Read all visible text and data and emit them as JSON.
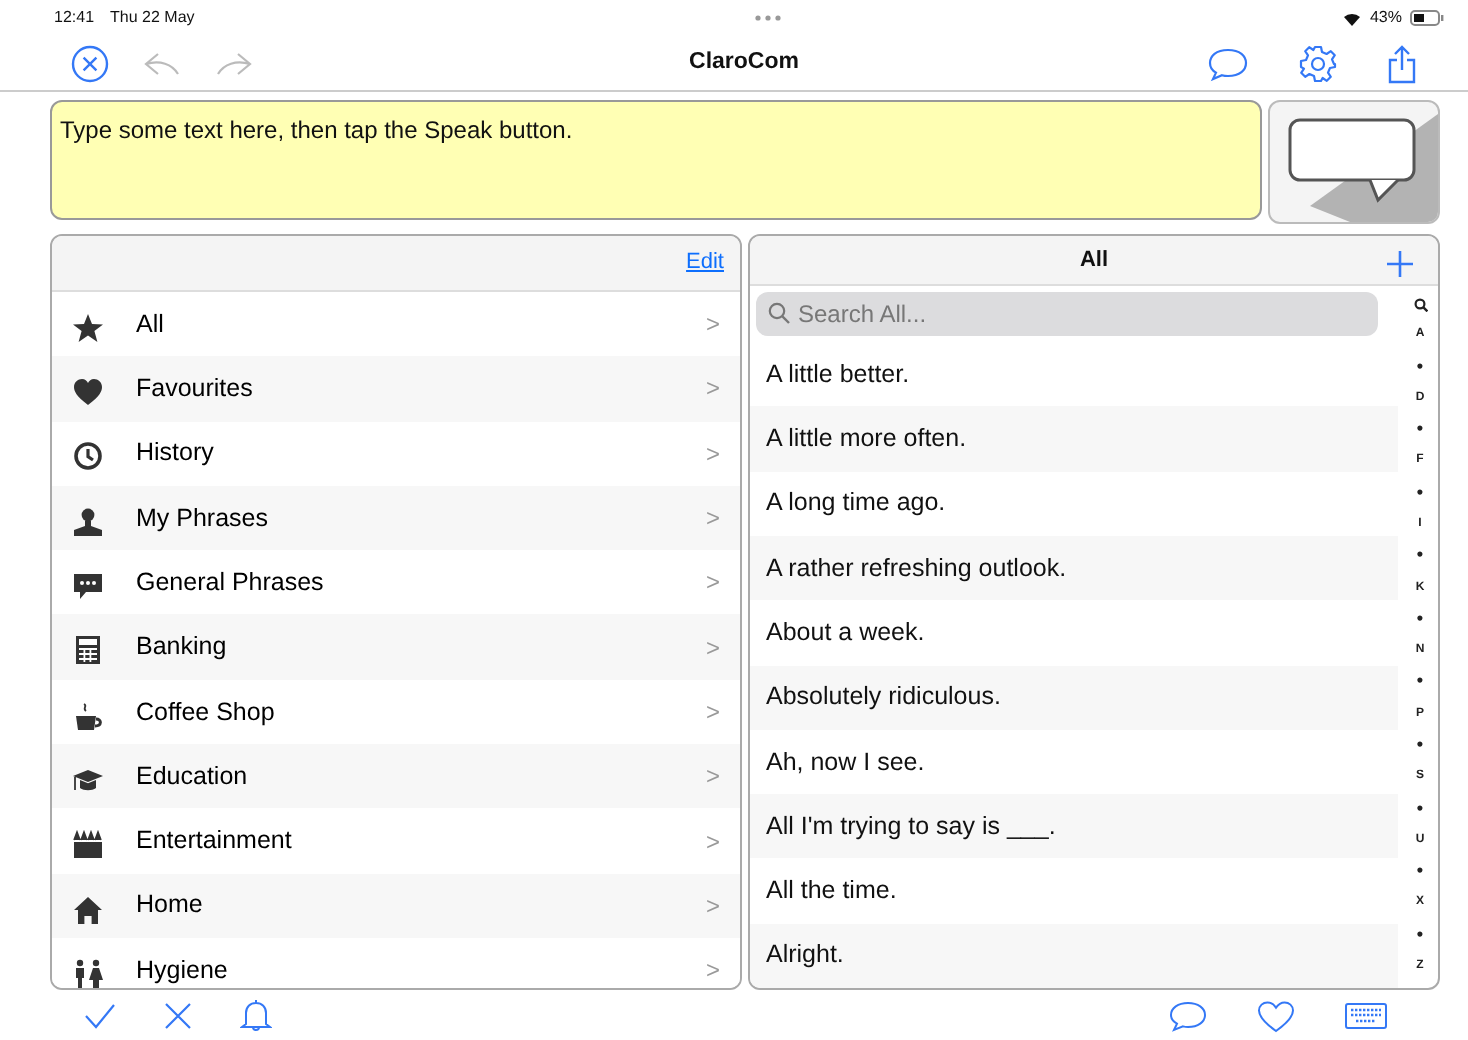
{
  "status_bar": {
    "time": "12:41",
    "date": "Thu 22 May",
    "battery": "43%"
  },
  "toolbar": {
    "title": "ClaroCom"
  },
  "speech": {
    "text": "Type some text here, then tap the Speak button."
  },
  "categories": {
    "edit": "Edit",
    "items": [
      {
        "label": "All",
        "chevron": ">"
      },
      {
        "label": "Favourites",
        "chevron": ">"
      },
      {
        "label": "History",
        "chevron": ">"
      },
      {
        "label": "My Phrases",
        "chevron": ">"
      },
      {
        "label": "General Phrases",
        "chevron": ">"
      },
      {
        "label": "Banking",
        "chevron": ">"
      },
      {
        "label": "Coffee Shop",
        "chevron": ">"
      },
      {
        "label": "Education",
        "chevron": ">"
      },
      {
        "label": "Entertainment",
        "chevron": ">"
      },
      {
        "label": "Home",
        "chevron": ">"
      },
      {
        "label": "Hygiene",
        "chevron": ">"
      }
    ]
  },
  "phrases": {
    "title": "All",
    "search": {
      "placeholder": "Search All..."
    },
    "items": [
      "A little better.",
      "A little more often.",
      "A long time ago.",
      "A rather refreshing outlook.",
      "About a week.",
      "Absolutely ridiculous.",
      "Ah, now I see.",
      "All I'm trying to say is ___.",
      "All the time.",
      "Alright."
    ],
    "index": [
      "A",
      "•",
      "D",
      "•",
      "F",
      "•",
      "I",
      "•",
      "K",
      "•",
      "N",
      "•",
      "P",
      "•",
      "S",
      "•",
      "U",
      "•",
      "X",
      "•",
      "Z"
    ]
  }
}
